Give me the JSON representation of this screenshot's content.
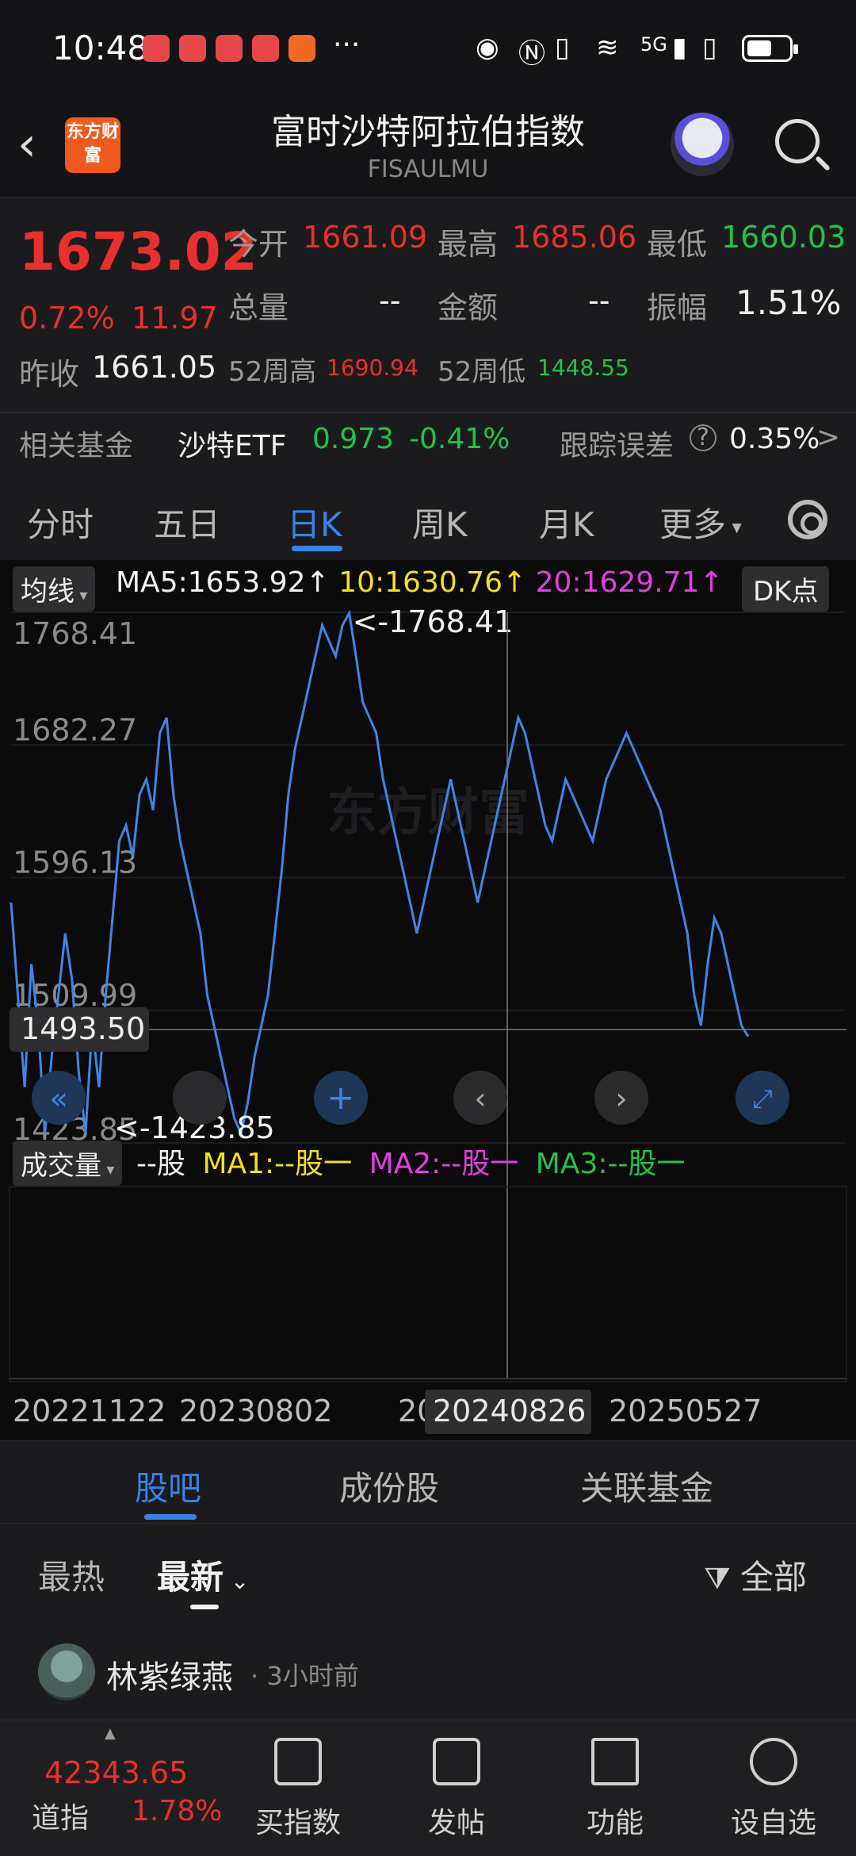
{
  "status_bar": {
    "time": "10:48",
    "network": "5G",
    "icons": [
      "eye-icon",
      "nfc-icon",
      "vibrate-icon",
      "wifi-icon",
      "signal-icon",
      "battery-icon"
    ]
  },
  "header": {
    "back": "‹",
    "logo_text": "东方财富",
    "title": "富时沙特阿拉伯指数",
    "code": "FISAULMU"
  },
  "quote": {
    "price": "1673.02",
    "change_pct": "0.72%",
    "change": "11.97",
    "open_label": "今开",
    "open": "1661.09",
    "high_label": "最高",
    "high": "1685.06",
    "low_label": "最低",
    "low": "1660.03",
    "volume_label": "总量",
    "volume": "--",
    "amount_label": "金额",
    "amount": "--",
    "amplitude_label": "振幅",
    "amplitude": "1.51%",
    "prev_close_label": "昨收",
    "prev_close": "1661.05",
    "wk52_high_label": "52周高",
    "wk52_high": "1690.94",
    "wk52_low_label": "52周低",
    "wk52_low": "1448.55",
    "fund_label": "相关基金",
    "fund_name": "沙特ETF",
    "fund_price": "0.973",
    "fund_change": "-0.41%",
    "tracking_label": "跟踪误差",
    "tracking_value": "0.35%",
    "tracking_arrow": ">"
  },
  "ktabs": [
    "分时",
    "五日",
    "日K",
    "周K",
    "月K",
    "更多"
  ],
  "chart_labels": {
    "ma_selector": "均线",
    "ma5": "MA5:1653.92↑",
    "ma10": "10:1630.76↑",
    "ma20": "20:1629.71↑",
    "dk_button": "DK点",
    "watermark": "东方财富",
    "crosshair_value": "1493.50",
    "vol_selector": "成交量",
    "vol_value": "--股",
    "vol_ma1": "MA1:--股一",
    "vol_ma2": "MA2:--股一",
    "vol_ma3": "MA3:--股一",
    "date_crosshair": "20240826"
  },
  "chart_data": {
    "type": "line",
    "y_ticks": [
      1768.41,
      1682.27,
      1596.13,
      1509.99,
      1423.85
    ],
    "y_tick_labels": [
      "1768.41",
      "1682.27",
      "1596.13",
      "1509.99",
      "1423.85"
    ],
    "ylim": [
      1423.85,
      1768.41
    ],
    "max_annotation": "<-1768.41",
    "min_annotation": "<-1423.85",
    "x_tick_labels": [
      "20221122",
      "20230802",
      "20",
      "20250527"
    ],
    "series": [
      {
        "values": [
          1580,
          1520,
          1460,
          1540,
          1500,
          1430,
          1480,
          1520,
          1560,
          1530,
          1470,
          1430,
          1500,
          1460,
          1520,
          1570,
          1620,
          1630,
          1610,
          1650,
          1660,
          1640,
          1690,
          1700,
          1650,
          1620,
          1600,
          1580,
          1560,
          1520,
          1500,
          1480,
          1460,
          1440,
          1430,
          1450,
          1480,
          1500,
          1520,
          1560,
          1600,
          1650,
          1680,
          1700,
          1720,
          1740,
          1760,
          1750,
          1740,
          1760,
          1768,
          1740,
          1710,
          1700,
          1690,
          1660,
          1640,
          1620,
          1600,
          1580,
          1560,
          1580,
          1600,
          1620,
          1640,
          1660,
          1640,
          1620,
          1600,
          1580,
          1600,
          1620,
          1640,
          1660,
          1680,
          1700,
          1690,
          1670,
          1650,
          1630,
          1620,
          1640,
          1660,
          1650,
          1640,
          1630,
          1620,
          1640,
          1660,
          1670,
          1680,
          1690,
          1680,
          1670,
          1660,
          1650,
          1640,
          1620,
          1600,
          1580,
          1560,
          1520,
          1500,
          1540,
          1570,
          1560,
          1540,
          1520,
          1500,
          1493
        ]
      }
    ]
  },
  "lower_tabs": [
    "股吧",
    "成份股",
    "关联基金"
  ],
  "sort": {
    "hot": "最热",
    "latest": "最新",
    "filter": "全部"
  },
  "post": {
    "author": "林紫绿燕",
    "time": "· 3小时前"
  },
  "bottom_nav": {
    "index_value": "42343.65",
    "index_name": "道指",
    "index_change": "1.78%",
    "items": [
      "买指数",
      "发帖",
      "功能",
      "设自选"
    ]
  }
}
